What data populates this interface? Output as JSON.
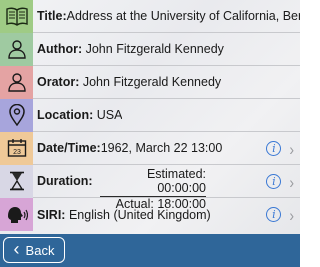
{
  "rows": {
    "title": {
      "label": "Title:",
      "value": "Address at the University of California, Ber...",
      "color": "#9fcb85"
    },
    "author": {
      "label": "Author:",
      "value": "John Fitzgerald Kennedy",
      "color": "#9fcaa1"
    },
    "orator": {
      "label": "Orator:",
      "value": "John Fitzgerald Kennedy",
      "color": "#e4a3a3"
    },
    "location": {
      "label": "Location:",
      "value": "USA",
      "color": "#a7a5dc"
    },
    "datetime": {
      "label": "Date/Time:",
      "value": "1962, March 22 13:00",
      "icon_text": "23",
      "color": "#efc998"
    },
    "duration": {
      "label": "Duration:",
      "estimated": "Estimated: 00:00:00",
      "actual": "Actual: 18:00:00",
      "color": "#d8d7e5"
    },
    "siri": {
      "label": "SIRI:",
      "value": "English (United Kingdom)",
      "color": "#d7a5d6"
    }
  },
  "info_icon": "i",
  "chevron": "›",
  "back": {
    "label": "Back",
    "chevron": "‹"
  },
  "colors": {
    "bar": "#2f6699",
    "accent": "#3a78d4"
  }
}
